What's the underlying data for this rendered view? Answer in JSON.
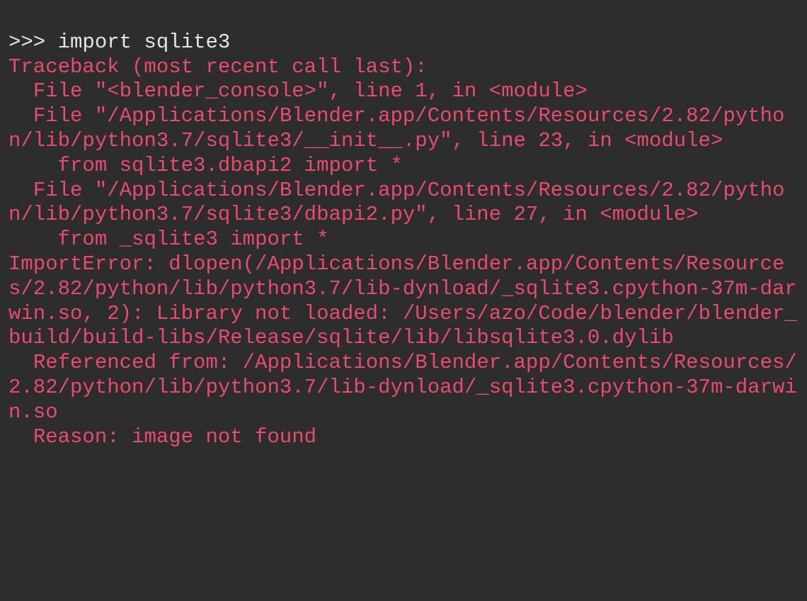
{
  "console": {
    "prompt": ">>> import sqlite3",
    "traceback": "Traceback (most recent call last):\n  File \"<blender_console>\", line 1, in <module>\n  File \"/Applications/Blender.app/Contents/Resources/2.82/python/lib/python3.7/sqlite3/__init__.py\", line 23, in <module>\n    from sqlite3.dbapi2 import *\n  File \"/Applications/Blender.app/Contents/Resources/2.82/python/lib/python3.7/sqlite3/dbapi2.py\", line 27, in <module>\n    from _sqlite3 import *\nImportError: dlopen(/Applications/Blender.app/Contents/Resources/2.82/python/lib/python3.7/lib-dynload/_sqlite3.cpython-37m-darwin.so, 2): Library not loaded: /Users/azo/Code/blender/blender_build/build-libs/Release/sqlite/lib/libsqlite3.0.dylib\n  Referenced from: /Applications/Blender.app/Contents/Resources/2.82/python/lib/python3.7/lib-dynload/_sqlite3.cpython-37m-darwin.so\n  Reason: image not found"
  }
}
